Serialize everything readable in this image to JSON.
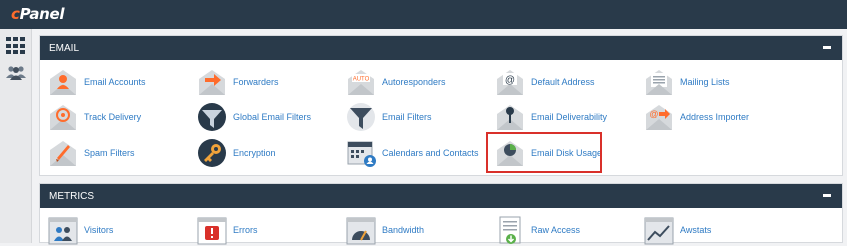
{
  "brand": {
    "logo_c": "c",
    "logo_rest": "Panel"
  },
  "sidebar": [
    {
      "icon": "apps-grid-icon"
    },
    {
      "icon": "users-icon"
    }
  ],
  "email": {
    "title": "EMAIL",
    "items": [
      {
        "label": "Email Accounts",
        "icon": "email-accounts-icon"
      },
      {
        "label": "Forwarders",
        "icon": "forwarders-icon"
      },
      {
        "label": "Autoresponders",
        "icon": "autoresponders-icon",
        "badge": "AUTO"
      },
      {
        "label": "Default Address",
        "icon": "default-address-icon",
        "badge": "@"
      },
      {
        "label": "Mailing Lists",
        "icon": "mailing-lists-icon"
      },
      {
        "label": "Track Delivery",
        "icon": "track-delivery-icon"
      },
      {
        "label": "Global Email Filters",
        "icon": "global-email-filters-icon"
      },
      {
        "label": "Email Filters",
        "icon": "email-filters-icon"
      },
      {
        "label": "Email Deliverability",
        "icon": "email-deliverability-icon"
      },
      {
        "label": "Address Importer",
        "icon": "address-importer-icon",
        "badge": "@"
      },
      {
        "label": "Spam Filters",
        "icon": "spam-filters-icon"
      },
      {
        "label": "Encryption",
        "icon": "encryption-icon"
      },
      {
        "label": "Calendars and Contacts",
        "icon": "calendars-contacts-icon"
      },
      {
        "label": "Email Disk Usage",
        "icon": "email-disk-usage-icon"
      }
    ]
  },
  "metrics": {
    "title": "METRICS",
    "items": [
      {
        "label": "Visitors",
        "icon": "visitors-icon"
      },
      {
        "label": "Errors",
        "icon": "errors-icon"
      },
      {
        "label": "Bandwidth",
        "icon": "bandwidth-icon"
      },
      {
        "label": "Raw Access",
        "icon": "raw-access-icon"
      },
      {
        "label": "Awstats",
        "icon": "awstats-icon"
      }
    ]
  },
  "colors": {
    "header": "#293a4a",
    "link": "#2f7bc4",
    "accent": "#ff6c2c",
    "highlight": "#d9302a"
  }
}
